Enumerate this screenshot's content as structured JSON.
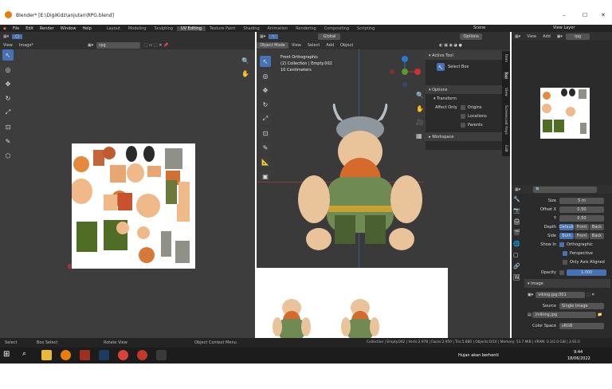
{
  "window": {
    "title": "Blender* [E:\\DigiKidz\\anjutan\\RPG.blend]",
    "min": "–",
    "max": "☐",
    "close": "✕"
  },
  "menu": [
    "File",
    "Edit",
    "Render",
    "Window",
    "Help"
  ],
  "workspaces": [
    "Layout",
    "Modeling",
    "Sculpting",
    "UV Editing",
    "Texture Paint",
    "Shading",
    "Animation",
    "Rendering",
    "Compositing",
    "Scripting"
  ],
  "active_workspace": "UV Editing",
  "scene": {
    "label": "Scene",
    "view_layer": "View Layer"
  },
  "uv_editor": {
    "menus": [
      "View",
      "Image*"
    ],
    "image_name": "rpg"
  },
  "viewport": {
    "mode": "Object Mode",
    "menus": [
      "View",
      "Select",
      "Add",
      "Object"
    ],
    "orientation": "Global",
    "options": "Options",
    "info": [
      "Front Orthographic",
      "(2) Collection | Empty.002",
      "10 Centimeters"
    ]
  },
  "npanel": {
    "active_tool": "Active Tool",
    "select_box": "Select Box",
    "options": "Options",
    "transform": "Transform",
    "affect_only": "Affect Only",
    "origins": "Origins",
    "locations": "Locations",
    "parents": "Parents",
    "workspace": "Workspace",
    "tabs": [
      "Item",
      "Tool",
      "View",
      "Screencast Keys",
      "Edit"
    ]
  },
  "props": {
    "menus": [
      "View",
      "Add"
    ],
    "name": "rpg",
    "fields": [
      {
        "label": "Size",
        "value": "5 m"
      },
      {
        "label": "Offset X",
        "value": "0.50"
      },
      {
        "label": "Y",
        "value": "0.50"
      }
    ],
    "depth": {
      "label": "Depth",
      "options": [
        "Default",
        "Front",
        "Back"
      ]
    },
    "side": {
      "label": "Side",
      "options": [
        "Both",
        "Front",
        "Back"
      ]
    },
    "show_in": {
      "label": "Show In",
      "items": [
        "Orthographic",
        "Perspective",
        "Only Axis Aligned"
      ]
    },
    "opacity": {
      "label": "Opacity",
      "value": "1.000"
    },
    "image_section": "Image",
    "image_name": "viking.jpg.001",
    "source": {
      "label": "Source",
      "value": "Single Image"
    },
    "filepath": "//viking.jpg",
    "color_space": {
      "label": "Color Space",
      "value": "sRGB"
    }
  },
  "status": {
    "select": "Select",
    "box_select": "Box Select",
    "rotate": "Rotate View",
    "context": "Object Context Menu",
    "stats": "Collection | Empty.002 | Verts:2.978 | Faces:2.950 | Tris:5.880 | Objects:0/10 | Memory: 53.7 MiB | VRAM: 0.3/2.0 GiB | 2.92.0"
  },
  "taskbar": {
    "weather": "Hujan akan berhenti",
    "time": "9:44",
    "date": "18/06/2022"
  }
}
